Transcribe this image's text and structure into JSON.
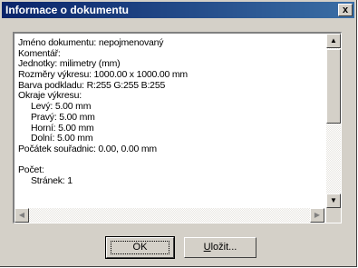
{
  "window": {
    "title": "Informace o dokumentu",
    "close_glyph": "x"
  },
  "content": {
    "lines": [
      "Jméno dokumentu: nepojmenovaný",
      "Komentář:",
      "Jednotky: milimetry (mm)",
      "Rozměry výkresu: 1000.00 x 1000.00 mm",
      "Barva podkladu: R:255 G:255 B:255",
      "Okraje výkresu:",
      "Levý: 5.00 mm",
      "Pravý: 5.00 mm",
      "Horní: 5.00 mm",
      "Dolní: 5.00 mm",
      "Počátek souřadnic: 0.00, 0.00 mm",
      "",
      "Počet:",
      "Stránek: 1"
    ]
  },
  "scrollbars": {
    "up_glyph": "▲",
    "down_glyph": "▼",
    "left_glyph": "◀",
    "right_glyph": "▶"
  },
  "buttons": {
    "ok_label": "OK",
    "save_label_mnemonic": "U",
    "save_label_rest": "ložit..."
  },
  "colors": {
    "title_start": "#0a246a",
    "title_end": "#3a6ea5",
    "face": "#d4d0c8"
  }
}
